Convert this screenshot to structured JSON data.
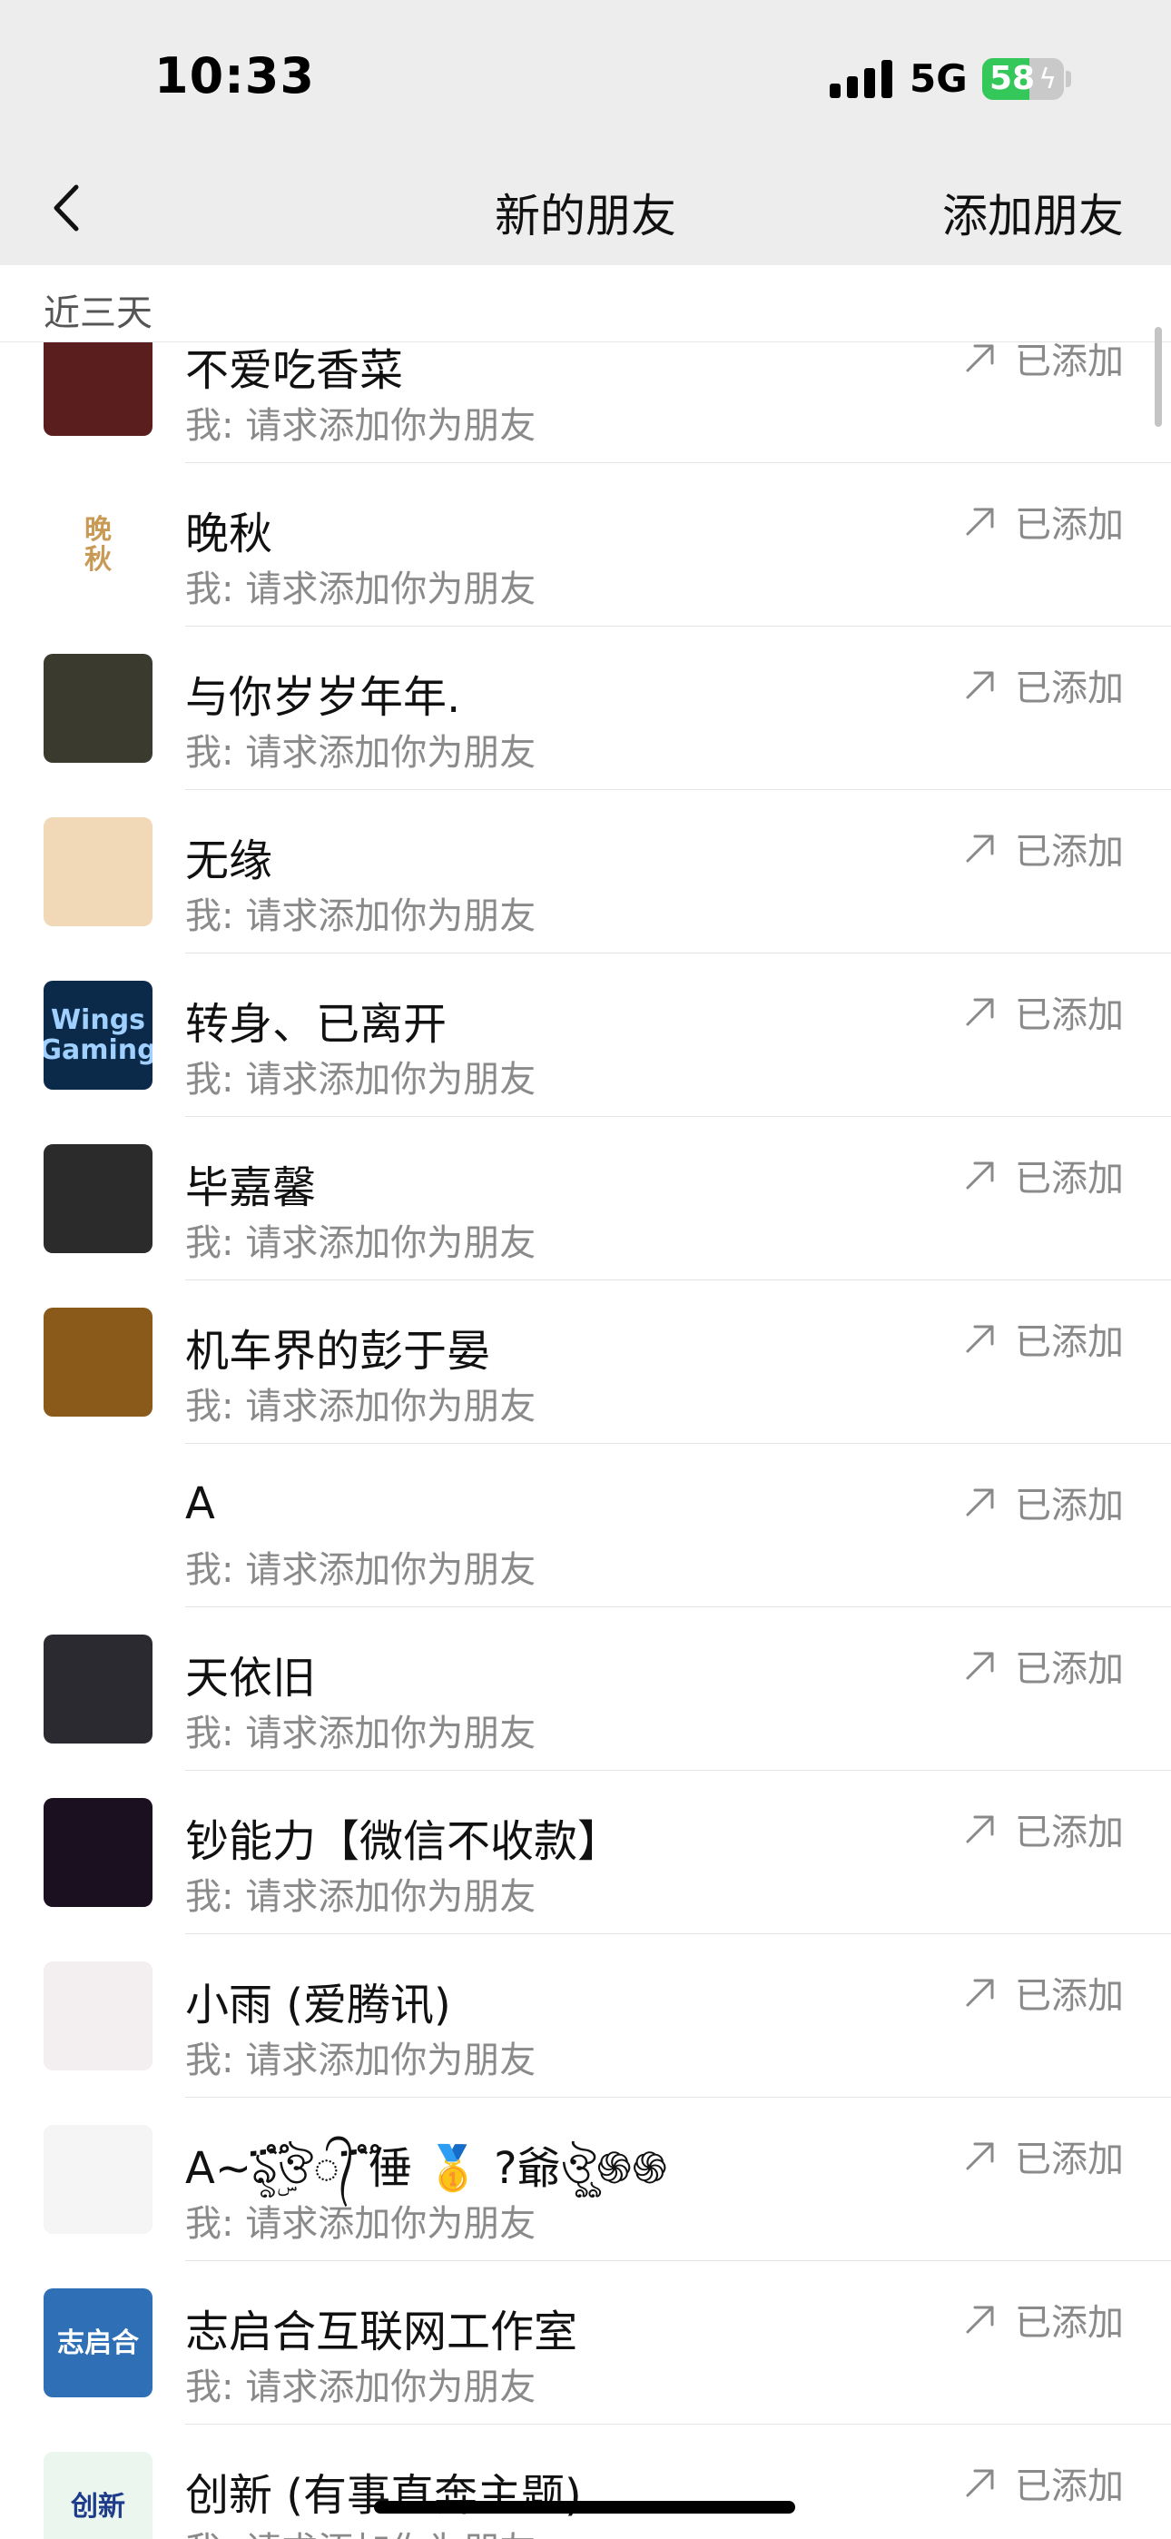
{
  "status_bar": {
    "time": "10:33",
    "network": "5G",
    "battery_level": "58",
    "battery_percent": 58,
    "battery_charging_icon": "bolt-icon"
  },
  "nav": {
    "back_icon": "chevron-left-icon",
    "title": "新的朋友",
    "action": "添加朋友"
  },
  "section": {
    "label": "近三天"
  },
  "colors": {
    "background": "#ffffff",
    "nav_background": "#ededed",
    "secondary_text": "#8a8a8a",
    "battery_green": "#34c759"
  },
  "requests": [
    {
      "name": "不爱吃香菜",
      "message": "我: 请求添加你为朋友",
      "status": "已添加",
      "avatar_text": "",
      "avatar_bg": "#5b1e1e",
      "avatar_color": "#f2d6c9"
    },
    {
      "name": "晚秋",
      "message": "我: 请求添加你为朋友",
      "status": "已添加",
      "avatar_text": "晚\n秋",
      "avatar_bg": "#ffffff",
      "avatar_color": "#c99a55"
    },
    {
      "name": "与你岁岁年年.",
      "message": "我: 请求添加你为朋友",
      "status": "已添加",
      "avatar_text": "",
      "avatar_bg": "#3a3a2e",
      "avatar_color": "#d9b24a"
    },
    {
      "name": "无缘",
      "message": "我: 请求添加你为朋友",
      "status": "已添加",
      "avatar_text": "",
      "avatar_bg": "#f1d9b8",
      "avatar_color": "#c22a2a"
    },
    {
      "name": "转身、已离开",
      "message": "我: 请求添加你为朋友",
      "status": "已添加",
      "avatar_text": "Wings Gaming",
      "avatar_bg": "#0b2a4a",
      "avatar_color": "#9fd0ff"
    },
    {
      "name": "毕嘉馨",
      "message": "我: 请求添加你为朋友",
      "status": "已添加",
      "avatar_text": "",
      "avatar_bg": "#2b2b2b",
      "avatar_color": "#777777"
    },
    {
      "name": "机车界的彭于晏",
      "message": "我: 请求添加你为朋友",
      "status": "已添加",
      "avatar_text": "",
      "avatar_bg": "#8a5a1a",
      "avatar_color": "#2a1a0a"
    },
    {
      "name": "A",
      "message": "我: 请求添加你为朋友",
      "status": "已添加",
      "avatar_text": "",
      "avatar_bg": "#ffffff",
      "avatar_color": "#d12222"
    },
    {
      "name": "天依旧",
      "message": "我: 请求添加你为朋友",
      "status": "已添加",
      "avatar_text": "",
      "avatar_bg": "#2a2a30",
      "avatar_color": "#aaaaaa"
    },
    {
      "name": "钞能力【微信不收款】",
      "message": "我: 请求添加你为朋友",
      "status": "已添加",
      "avatar_text": "",
      "avatar_bg": "#1a1020",
      "avatar_color": "#e02020"
    },
    {
      "name": "小雨 (爱腾讯)",
      "message": "我: 请求添加你为朋友",
      "status": "已添加",
      "avatar_text": "",
      "avatar_bg": "#f3eef0",
      "avatar_color": "#f4a9c0"
    },
    {
      "name": "A~ৡۣ፝֟ঔ᭄ ፝֟倕 🥇 ?爺ঔৣ֍֍",
      "message": "我: 请求添加你为朋友",
      "status": "已添加",
      "avatar_text": "",
      "avatar_bg": "#f5f5f5",
      "avatar_color": "#e8c7a8"
    },
    {
      "name": "志启合互联网工作室",
      "message": "我: 请求添加你为朋友",
      "status": "已添加",
      "avatar_text": "志启合",
      "avatar_bg": "#2e6fb5",
      "avatar_color": "#ffffff"
    },
    {
      "name": "创新 (有事直奔主题)",
      "message": "我: 请求添加你为朋友",
      "status": "已添加",
      "avatar_text": "创新",
      "avatar_bg": "#eaf6ee",
      "avatar_color": "#1f3c8a"
    }
  ]
}
